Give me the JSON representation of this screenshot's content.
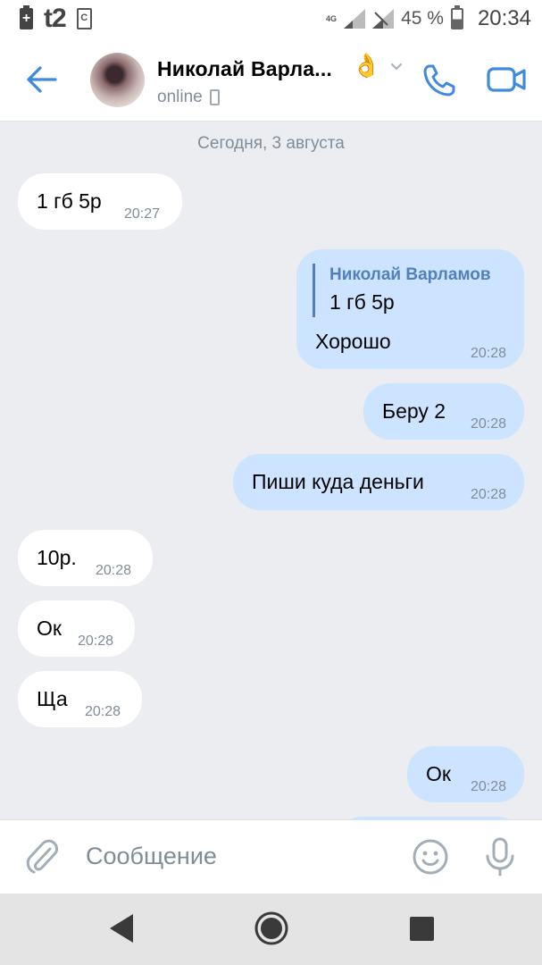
{
  "status_bar": {
    "carrier": "t2",
    "sim_icon_label": "C",
    "network": "4G",
    "battery_pct": "45 %",
    "time": "20:34"
  },
  "header": {
    "contact_name": "Николай Варла...",
    "emoji": "👌",
    "status": "online",
    "icons": {
      "back": "arrow-left-icon",
      "call": "phone-icon",
      "video": "video-camera-icon",
      "more": "chevron-down-icon"
    }
  },
  "chat": {
    "date_divider": "Сегодня, 3 августа",
    "messages": [
      {
        "direction": "in",
        "text": "1 гб 5р",
        "time": "20:27"
      },
      {
        "direction": "out",
        "reply_to": {
          "author": "Николай Варламов",
          "text": "1 гб 5р"
        },
        "text": "Хорошо",
        "time": "20:28"
      },
      {
        "direction": "out",
        "text": "Беру 2",
        "time": "20:28"
      },
      {
        "direction": "out",
        "text": "Пиши куда деньги",
        "time": "20:28"
      },
      {
        "direction": "in",
        "text": "10р.",
        "time": "20:28"
      },
      {
        "direction": "in",
        "text": "Ок",
        "time": "20:28"
      },
      {
        "direction": "in",
        "text": "Ща",
        "time": "20:28"
      },
      {
        "direction": "out",
        "text": "Ок",
        "time": "20:28"
      }
    ]
  },
  "composer": {
    "placeholder": "Сообщение",
    "value": "",
    "icons": {
      "attach": "paperclip-icon",
      "emoji": "smile-icon",
      "voice": "microphone-icon"
    }
  },
  "nav_bar": {
    "icons": {
      "back": "nav-back-icon",
      "home": "nav-home-icon",
      "recents": "nav-recents-icon"
    }
  },
  "colors": {
    "accent": "#3f8ae0",
    "incoming_bubble": "#ffffff",
    "outgoing_bubble": "#cce4ff",
    "background": "#ebedf0",
    "secondary_text": "#818c99",
    "quote_name": "#5181b8"
  }
}
